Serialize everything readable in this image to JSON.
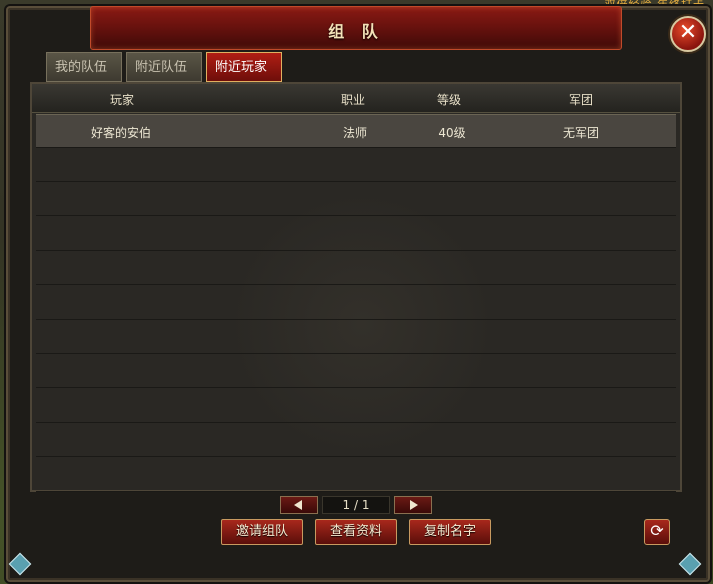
{
  "overlay_text": "双倍经验  年终打卡",
  "window": {
    "title": "组 队",
    "close_symbol": "✕"
  },
  "tabs": [
    {
      "label": "我的队伍",
      "active": false
    },
    {
      "label": "附近队伍",
      "active": false
    },
    {
      "label": "附近玩家",
      "active": true
    }
  ],
  "table": {
    "headers": [
      "玩家",
      "职业",
      "等级",
      "军团"
    ],
    "rows": [
      {
        "player": "好客的安伯",
        "class": "法师",
        "level": "40级",
        "legion": "无军团"
      }
    ],
    "empty_rows": 10
  },
  "pagination": {
    "indicator": "1 / 1"
  },
  "actions": {
    "invite": "邀请组队",
    "view_profile": "查看资料",
    "copy_name": "复制名字",
    "refresh_symbol": "⟳"
  },
  "colors": {
    "accent_red": "#8a1a14",
    "active_tab_border": "#e0b060",
    "text": "#ece6d2"
  }
}
